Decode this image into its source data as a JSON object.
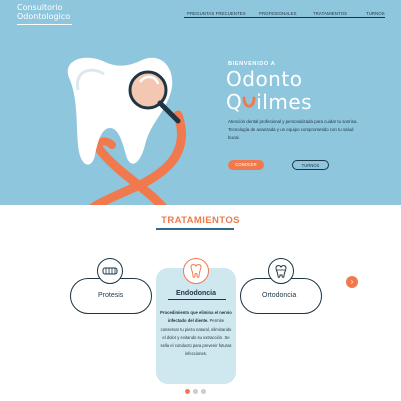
{
  "header": {
    "logo_line1": "Consultorio",
    "logo_line2": "Odontologico",
    "nav": [
      {
        "label": "PREGUNTAS FRECUENTES"
      },
      {
        "label": "PROFESIONALES"
      },
      {
        "label": "TRATAMIENTOS"
      },
      {
        "label": "TURNOS"
      }
    ]
  },
  "hero": {
    "welcome": "BIENVENIDO A",
    "brand_line1": "Odonto",
    "brand_line2_a": "Q",
    "brand_line2_b": "ilmes",
    "description": "Atención dental profesional y personalizada para cuidar tu sonrisa. Tecnología de avanzada y un equipo comprometido con tu salud bucal.",
    "btn_conocer": "CONOCER",
    "btn_turnos": "TURNOS"
  },
  "treatments": {
    "title": "TRATAMIENTOS",
    "cards": [
      {
        "label": "Protesis"
      },
      {
        "label": "Endodoncia",
        "desc_bold": "Procedimiento que elimina el nervio infectado del diente.",
        "desc_rest": "Permite conservar tu pieza natural, eliminando el dolor y evitando su extracción. Se sella el conducto para prevenir futuras infecciones."
      },
      {
        "label": "Ortodoncia"
      }
    ],
    "next_label": "›",
    "dots": 3,
    "active_dot": 0
  },
  "colors": {
    "hero_bg": "#8ec6dd",
    "accent": "#f07a4e",
    "dark": "#1e3544",
    "card_bg": "#cfe7ee"
  }
}
